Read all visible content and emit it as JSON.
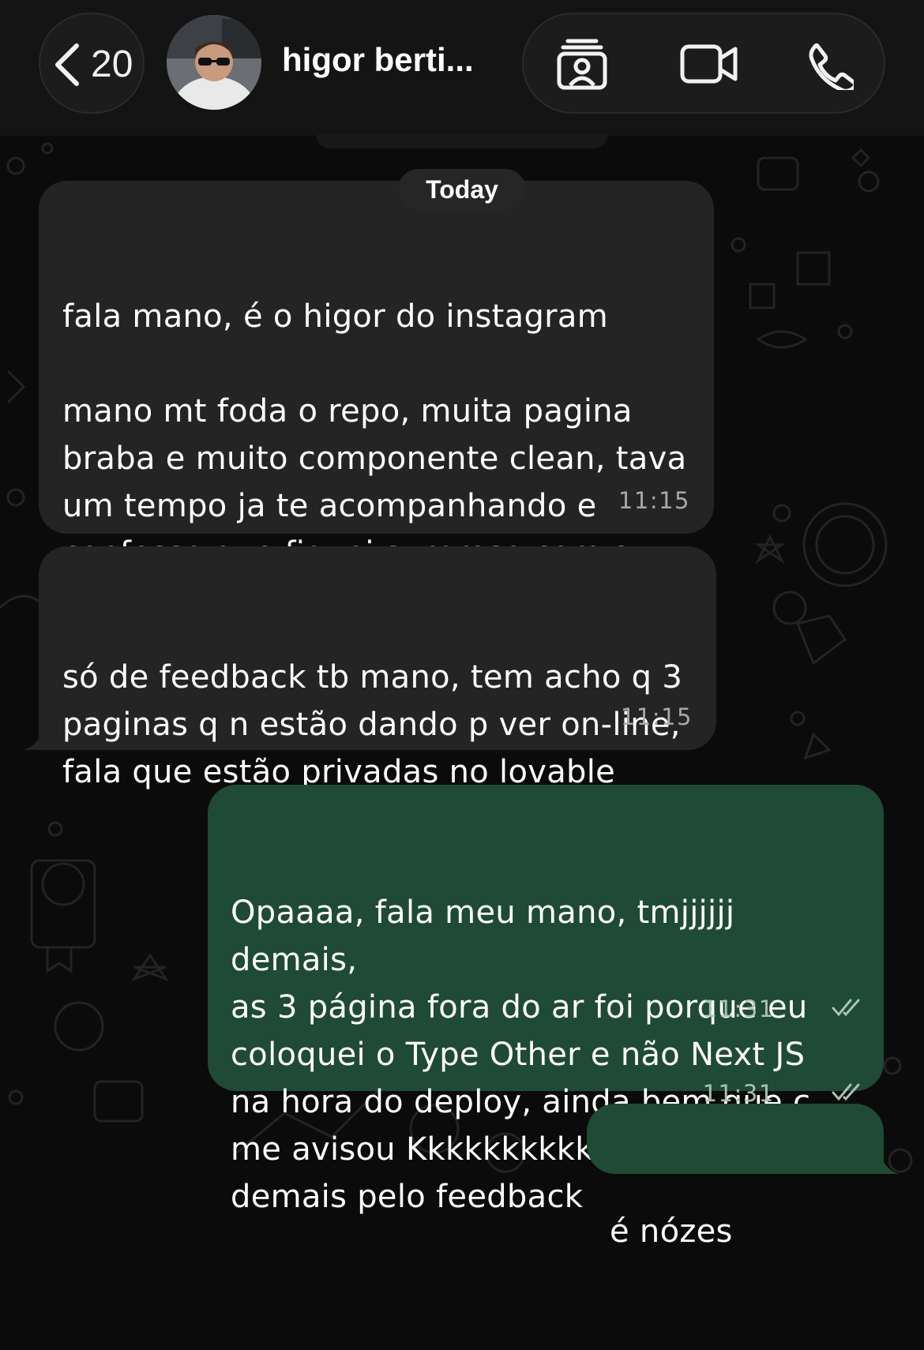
{
  "header": {
    "back_count": "20",
    "contact_name": "higor berti...",
    "icons": [
      "chevron-left-icon",
      "contact-card-icon",
      "video-call-icon",
      "phone-icon"
    ]
  },
  "date_separator": "Today",
  "messages": [
    {
      "direction": "incoming",
      "text": "fala mano, é o higor do instagram\n\nmano mt foda o repo, muita pagina\nbraba e muito componente clean, tava\num tempo ja te acompanhando e\nconfesso que fiquei surpreso com a\nqualidade",
      "time": "11:15"
    },
    {
      "direction": "incoming",
      "text": "só de feedback tb mano, tem acho q 3\npaginas q n estão dando p ver on-line,\nfala que estão privadas no lovable",
      "time": "11:15"
    },
    {
      "direction": "outgoing",
      "text": "Opaaaa, fala meu mano, tmjjjjjj demais,\nas 3 página fora do ar foi porque eu\ncoloquei o Type Other e não Next JS\nna hora do deploy, ainda bem que c\nme avisou Kkkkkkkkkkkkk, tmjjjj\ndemais pelo feedback",
      "time": "11:31",
      "status": "read"
    },
    {
      "direction": "outgoing",
      "text": "é nózes",
      "time": "11:31",
      "status": "read"
    }
  ],
  "colors": {
    "background": "#0b0b0b",
    "incoming_bubble": "#242424",
    "outgoing_bubble": "#1f4a35",
    "header": "#141414"
  }
}
